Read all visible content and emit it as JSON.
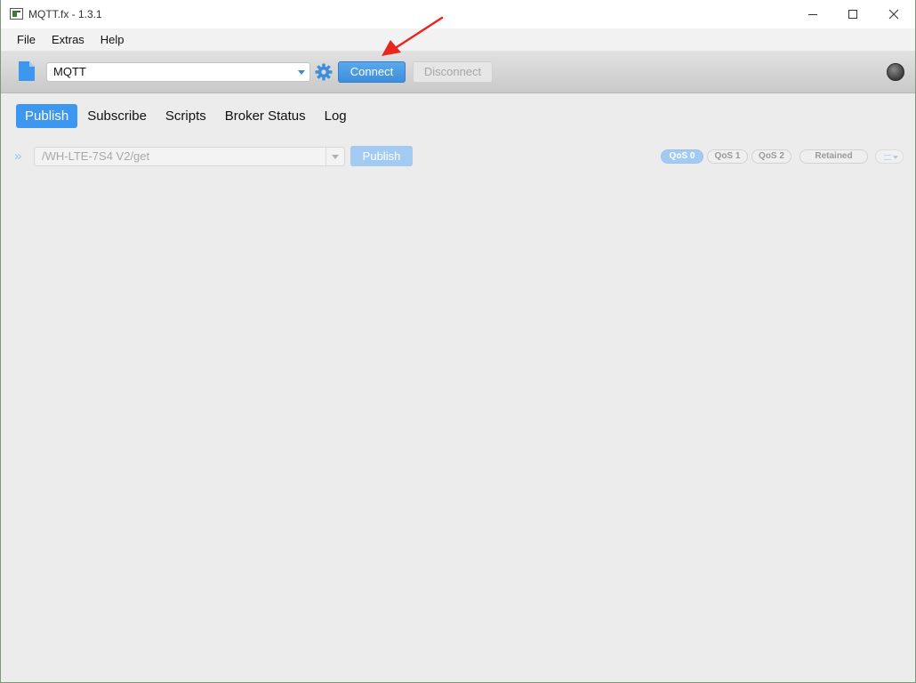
{
  "window": {
    "title": "MQTT.fx - 1.3.1"
  },
  "menu": {
    "items": [
      "File",
      "Extras",
      "Help"
    ]
  },
  "toolbar": {
    "profile": "MQTT",
    "connect_label": "Connect",
    "disconnect_label": "Disconnect",
    "connect_color": "#3d8edb",
    "status": "disconnected"
  },
  "tabs": [
    {
      "label": "Publish",
      "active": true
    },
    {
      "label": "Subscribe",
      "active": false
    },
    {
      "label": "Scripts",
      "active": false
    },
    {
      "label": "Broker Status",
      "active": false
    },
    {
      "label": "Log",
      "active": false
    }
  ],
  "publish": {
    "topic": "/WH-LTE-7S4 V2/get",
    "publish_label": "Publish",
    "qos": [
      "QoS 0",
      "QoS 1",
      "QoS 2"
    ],
    "qos_selected": "QoS 0",
    "retained_label": "Retained"
  },
  "colors": {
    "accent": "#3d97f0",
    "annotation": "#e8261e"
  }
}
